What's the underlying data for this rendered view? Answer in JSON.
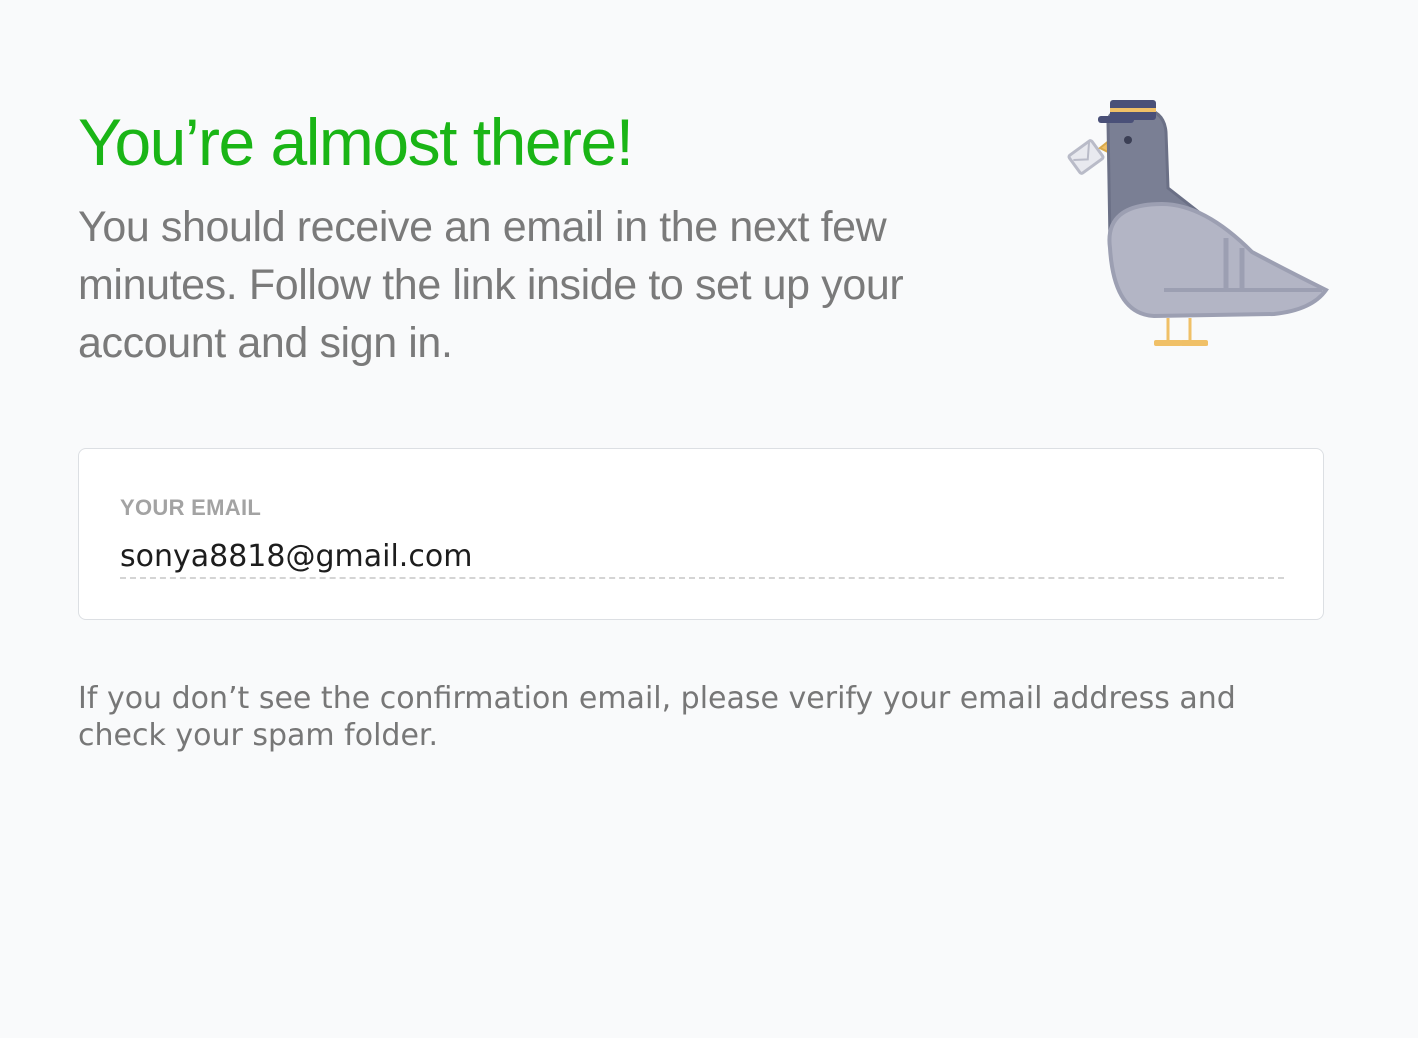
{
  "headline": "You’re almost there!",
  "subtext": "You should receive an email in the next few minutes. Follow the link inside to set up your account and sign in.",
  "email_field": {
    "label": "YOUR EMAIL",
    "value": "sonya8818@gmail.com"
  },
  "note": "If you don’t see the confirmation email, please verify your email address and check your spam folder.",
  "illustration": {
    "icon": "pigeon-icon",
    "carries": "envelope-icon"
  },
  "colors": {
    "background": "#f9fafb",
    "headline": "#1ab516",
    "body_text": "#7a7a7a",
    "label": "#a3a3a3",
    "card_border": "#dcdfe3",
    "pigeon_body": "#7a7f94",
    "pigeon_wing": "#b3b5c5",
    "cap": "#4a5078",
    "accent_gold": "#f0c067"
  }
}
